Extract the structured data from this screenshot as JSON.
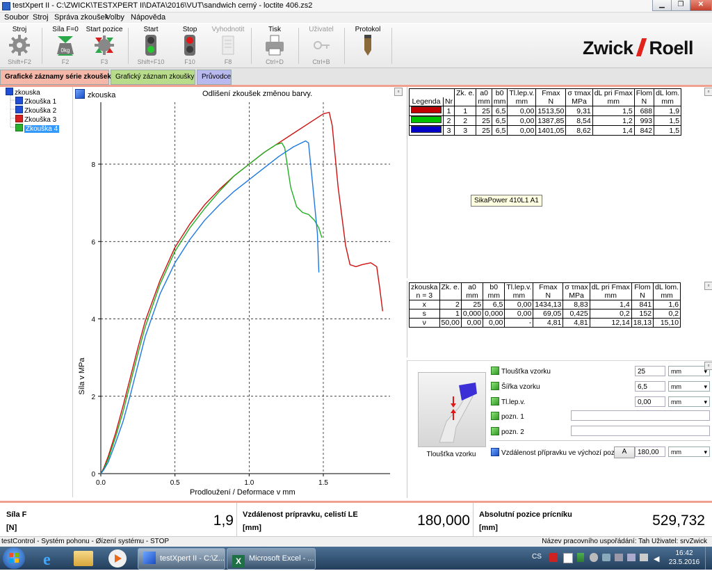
{
  "window": {
    "title": "testXpert II - C:\\ZWICK\\TESTXPERT II\\DATA\\2016\\VUT\\sandwich cerný - loctite 406.zs2",
    "min": "▁",
    "restore": "❐",
    "close": "✕"
  },
  "menu": [
    "Soubor",
    "Stroj",
    "Správa zkoušek",
    "Volby",
    "Nápověda"
  ],
  "toolbar": [
    {
      "label": "Stroj",
      "key": "Shift+F2",
      "icon": "gear-icon"
    },
    {
      "label": "Síla F=0",
      "key": "F2",
      "icon": "weight-zero-icon",
      "weight": "0kg"
    },
    {
      "label": "Start pozice",
      "key": "F3",
      "icon": "start-position-gear-icon"
    },
    {
      "label": "Start",
      "key": "Shift+F10",
      "icon": "traffic-light-green-icon"
    },
    {
      "label": "Stop",
      "key": "F10",
      "icon": "traffic-light-red-icon"
    },
    {
      "label": "Vyhodnotit",
      "key": "F8",
      "icon": "evaluate-document-icon"
    },
    {
      "label": "Tisk",
      "key": "Ctrl+D",
      "icon": "printer-icon"
    },
    {
      "label": "Uživatel",
      "key": "Ctrl+B",
      "icon": "user-key-icon"
    },
    {
      "label": "Protokol",
      "key": "",
      "icon": "pen-icon"
    }
  ],
  "logo": {
    "left": "Zwick",
    "right": "Roell"
  },
  "tabs": [
    {
      "label": "Grafické záznamy série zkoušek",
      "color": "#f4b7a8"
    },
    {
      "label": "Grafický záznam zkoušky",
      "color": "#b9dc8c"
    },
    {
      "label": "Průvodce",
      "color": "#b8b9ef"
    }
  ],
  "tree": {
    "root": "zkouska",
    "items": [
      {
        "label": "Zkouška 1",
        "color": "#1f4fd6"
      },
      {
        "label": "Zkouška 2",
        "color": "#1f4fd6"
      },
      {
        "label": "Zkouška 3",
        "color": "#d62020"
      },
      {
        "label": "Zkouška 4",
        "color": "#29b12c"
      }
    ]
  },
  "graph": {
    "header": "zkouska",
    "subtitle": "Odlišení zkoušek změnou barvy."
  },
  "chart_data": {
    "type": "line",
    "title": "Odlišení zkoušek změnou barvy.",
    "xlabel": "Prodloužení / Deformace v mm",
    "ylabel": "Síla v MPa",
    "xlim": [
      0,
      1.95
    ],
    "ylim": [
      0,
      9.6
    ],
    "xticks": [
      "0.0",
      "0.5",
      "1.0",
      "1.5"
    ],
    "yticks": [
      "0",
      "2",
      "4",
      "6",
      "8"
    ],
    "grid": true,
    "series": [
      {
        "color": "#cc1010",
        "x": [
          0,
          0.02,
          0.05,
          0.1,
          0.15,
          0.2,
          0.25,
          0.3,
          0.4,
          0.5,
          0.6,
          0.7,
          0.8,
          0.9,
          1.0,
          1.1,
          1.2,
          1.3,
          1.4,
          1.5,
          1.54,
          1.56,
          1.6,
          1.65,
          1.68,
          1.72,
          1.76,
          1.82,
          1.86,
          1.88,
          1.9
        ],
        "y": [
          0,
          0.15,
          0.45,
          1.05,
          1.75,
          2.5,
          3.25,
          3.95,
          5.0,
          5.85,
          6.45,
          6.95,
          7.35,
          7.7,
          8.0,
          8.3,
          8.55,
          8.8,
          9.05,
          9.3,
          9.34,
          9.0,
          7.4,
          5.9,
          5.4,
          5.35,
          5.4,
          5.45,
          5.35,
          4.8,
          4.2
        ]
      },
      {
        "color": "#20b020",
        "x": [
          0,
          0.02,
          0.05,
          0.1,
          0.15,
          0.2,
          0.25,
          0.3,
          0.4,
          0.5,
          0.6,
          0.7,
          0.8,
          0.9,
          1.0,
          1.1,
          1.18,
          1.22,
          1.24,
          1.26,
          1.28,
          1.32,
          1.36,
          1.4,
          1.44,
          1.47,
          1.49
        ],
        "y": [
          0,
          0.12,
          0.38,
          0.95,
          1.6,
          2.35,
          3.1,
          3.8,
          4.9,
          5.75,
          6.35,
          6.85,
          7.3,
          7.7,
          8.0,
          8.3,
          8.5,
          8.55,
          8.42,
          7.9,
          7.4,
          6.9,
          6.75,
          6.7,
          6.55,
          6.35,
          6.1
        ]
      },
      {
        "color": "#1c78e0",
        "x": [
          0,
          0.02,
          0.05,
          0.1,
          0.15,
          0.2,
          0.25,
          0.3,
          0.4,
          0.5,
          0.6,
          0.7,
          0.8,
          0.9,
          1.0,
          1.1,
          1.2,
          1.3,
          1.38,
          1.4,
          1.43,
          1.46,
          1.47
        ],
        "y": [
          0,
          0.1,
          0.3,
          0.8,
          1.35,
          2.05,
          2.8,
          3.55,
          4.65,
          5.45,
          6.05,
          6.55,
          6.95,
          7.3,
          7.6,
          7.9,
          8.2,
          8.45,
          8.6,
          8.55,
          7.4,
          6.2,
          5.2
        ]
      }
    ]
  },
  "results": {
    "headers": [
      "Legenda",
      "Nr",
      "Zk. e.",
      "a0",
      "b0",
      "Tl.lep.v.",
      "Fmax",
      "σ τmax",
      "dL pri Fmax",
      "Flom",
      "dL lom."
    ],
    "units": [
      "Legenda",
      "Nr",
      "",
      "mm",
      "mm",
      "mm",
      "N",
      "MPa",
      "mm",
      "N",
      "mm"
    ],
    "rows": [
      {
        "color": "#c00000",
        "cells": [
          "1",
          "1",
          "25",
          "6,5",
          "0,00",
          "1513,50",
          "9,31",
          "1,5",
          "688",
          "1,9"
        ]
      },
      {
        "color": "#00c000",
        "cells": [
          "2",
          "2",
          "25",
          "6,5",
          "0,00",
          "1387,85",
          "8,54",
          "1,2",
          "993",
          "1,5"
        ]
      },
      {
        "color": "#0000c8",
        "cells": [
          "3",
          "3",
          "25",
          "6,5",
          "0,00",
          "1401,05",
          "8,62",
          "1,4",
          "842",
          "1,5"
        ]
      }
    ],
    "tooltip": "SikaPower 410L1 A1"
  },
  "stats": {
    "headers": [
      "zkouska",
      "Zk. e.",
      "a0",
      "b0",
      "Tl.lep.v.",
      "Fmax",
      "σ τmax",
      "dL pri Fmax",
      "Flom",
      "dL lom."
    ],
    "units": [
      "n = 3",
      "",
      "mm",
      "mm",
      "mm",
      "N",
      "MPa",
      "mm",
      "N",
      "mm"
    ],
    "rows": [
      [
        "x",
        "2",
        "25",
        "6,5",
        "0,00",
        "1434,13",
        "8,83",
        "1,4",
        "841",
        "1,6"
      ],
      [
        "s",
        "1",
        "0,000",
        "0,000",
        "0,00",
        "69,05",
        "0,425",
        "0,2",
        "152",
        "0,2"
      ],
      [
        "ν",
        "50,00",
        "0,00",
        "0,00",
        "-",
        "4,81",
        "4,81",
        "12,14",
        "18,13",
        "15,10"
      ]
    ]
  },
  "params": {
    "image_caption": "Tloušťka vzorku",
    "rows": [
      {
        "label": "Tloušťka vzorku",
        "value": "25",
        "unit": "mm"
      },
      {
        "label": "Šířka vzorku",
        "value": "6,5",
        "unit": "mm"
      },
      {
        "label": "Tl.lep.v.",
        "value": "0,00",
        "unit": "mm"
      },
      {
        "label": "pozn. 1",
        "value": "",
        "unit": ""
      },
      {
        "label": "pozn. 2",
        "value": "",
        "unit": ""
      }
    ],
    "distance": {
      "label": "Vzdálenost přípravku ve výchozí pozici",
      "button": "A",
      "value": "180,00",
      "unit": "mm"
    }
  },
  "readouts": [
    {
      "title": "Síla F",
      "unit": "[N]",
      "value": "1,9"
    },
    {
      "title": "Vzdálenost prípravku, celistí LE",
      "unit": "[mm]",
      "value": "180,000"
    },
    {
      "title": "Absolutní pozice prícníku",
      "unit": "[mm]",
      "value": "529,732"
    }
  ],
  "status": {
    "left": "testControl - Systém pohonu - Øízení systému - STOP",
    "right": "Název pracovního uspořádání: Tah  Uživatel: srvZwick"
  },
  "taskbar": {
    "items": [
      {
        "label": "testXpert II - C:\\Z..."
      },
      {
        "label": "Microsoft Excel - ..."
      }
    ],
    "lang": "CS",
    "time": "16:42",
    "date": "23.5.2016"
  }
}
